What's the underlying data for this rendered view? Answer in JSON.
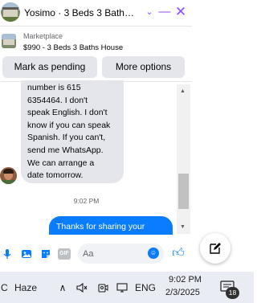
{
  "chat": {
    "title": "Yosimo · 3 Beds 3 Baths H...",
    "marketplace_label": "Marketplace",
    "listing_title": "$990 - 3 Beds 3 Baths House",
    "buttons": {
      "pending": "Mark as pending",
      "options": "More options"
    },
    "incoming_message": "number is 615\n6354464. I don't\nspeak English. I don't\nknow if you can speak\nSpanish. If you can't,\nsend me WhatsApp.\nWe can arrange a\ndate tomorrow.",
    "timestamp": "9:02 PM",
    "outgoing_message": "Thanks for sharing your",
    "composer_placeholder": "Aa",
    "gif_label": "GIF"
  },
  "taskbar": {
    "weather_partial": "C",
    "weather": "Haze",
    "language": "ENG",
    "time": "9:02 PM",
    "date": "2/3/2025",
    "notification_count": "18"
  },
  "colors": {
    "accent": "#8a4dff",
    "messenger_blue": "#0a7cff",
    "bubble_gray": "#e4e6eb",
    "taskbar": "#e9edf3"
  },
  "icons": [
    "chevron-down-icon",
    "minimize-icon",
    "close-icon",
    "microphone-icon",
    "image-icon",
    "sticker-icon",
    "gif-icon",
    "emoji-icon",
    "like-icon",
    "compose-icon",
    "chevron-up-icon",
    "volume-icon",
    "camera-icon",
    "network-icon",
    "notification-icon"
  ]
}
